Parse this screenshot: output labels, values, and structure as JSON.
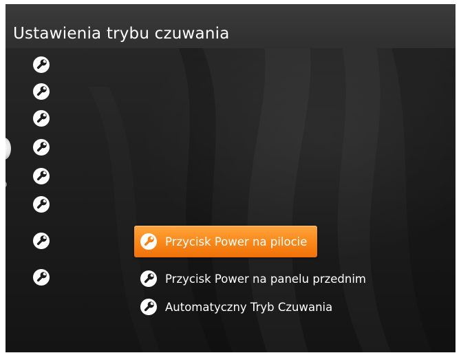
{
  "screen": {
    "title": "Ustawienia trybu czuwania"
  },
  "sidebar": {
    "icons": [
      "wrench-icon",
      "wrench-icon",
      "wrench-icon",
      "wrench-icon",
      "wrench-icon",
      "wrench-icon",
      "wrench-icon",
      "wrench-icon"
    ]
  },
  "menu": {
    "items": [
      {
        "label": "Przycisk Power na pilocie",
        "icon": "wrench-icon",
        "selected": true
      },
      {
        "label": "Przycisk Power na panelu przednim",
        "icon": "wrench-icon",
        "selected": false
      },
      {
        "label": "Automatyczny Tryb Czuwania",
        "icon": "wrench-icon",
        "selected": false
      }
    ]
  },
  "colors": {
    "accent": "#f7851a",
    "background": "#1f1f1f",
    "title_bar": "#333333",
    "text": "#ffffff"
  }
}
